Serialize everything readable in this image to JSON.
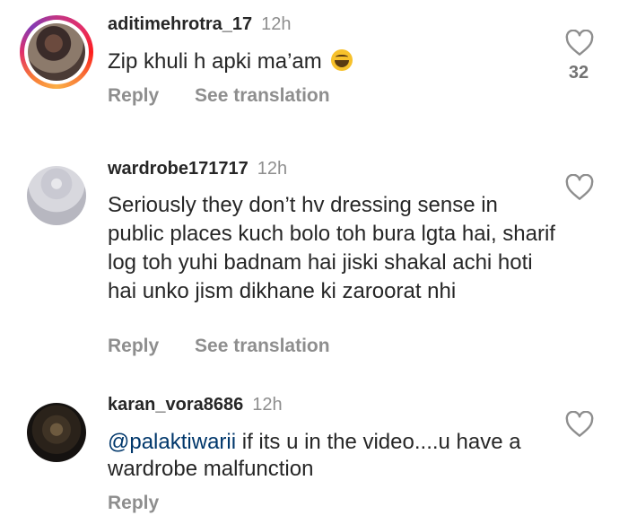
{
  "comments": [
    {
      "username": "aditimehrotra_17",
      "time": "12h",
      "text": "Zip khuli h apki ma’am",
      "emoji_icon": "grinning-sweat-emoji",
      "likes": "32",
      "actions": [
        "Reply",
        "See translation"
      ]
    },
    {
      "username": "wardrobe171717",
      "time": "12h",
      "text": "Seriously they don’t hv dressing sense in public places kuch bolo toh bura lgta hai, sharif log toh yuhi badnam hai jiski shakal achi hoti hai unko jism dikhane ki zaroorat nhi",
      "actions": [
        "Reply",
        "See translation"
      ]
    },
    {
      "username": "karan_vora8686",
      "time": "12h",
      "mention": "@palaktiwarii",
      "text": " if its u in the video....u have a wardrobe malfunction",
      "actions": [
        "Reply"
      ]
    }
  ]
}
